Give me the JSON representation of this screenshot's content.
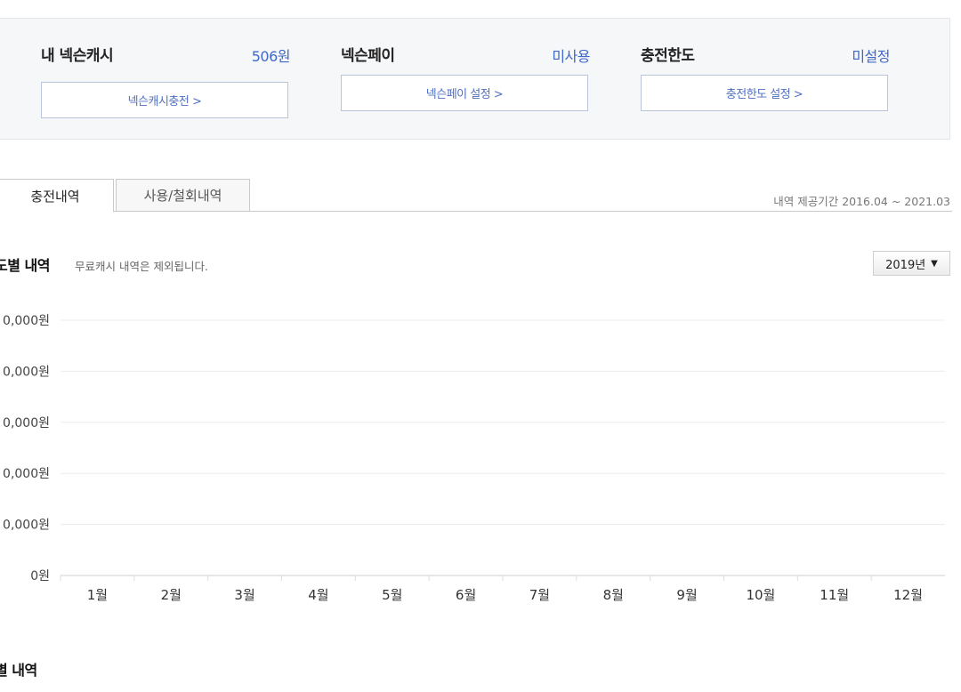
{
  "summary": {
    "cash": {
      "title": "내 넥슨캐시",
      "value": "506원",
      "button": "넥슨캐시충전 >"
    },
    "pay": {
      "title": "넥슨페이",
      "value": "미사용",
      "button": "넥슨페이 설정 >"
    },
    "limit": {
      "title": "충전한도",
      "value": "미설정",
      "button": "충전한도 설정 >"
    }
  },
  "tabs": [
    {
      "label": "충전내역",
      "active": true
    },
    {
      "label": "사용/철회내역",
      "active": false
    }
  ],
  "period_text": "내역 제공기간 2016.04 ~ 2021.03",
  "monthly_section": {
    "title": "도별 내역",
    "note": "무료캐시 내역은 제외됩니다.",
    "year_select": "2019년",
    "year_caret": "▼"
  },
  "chart_data": {
    "type": "bar",
    "categories": [
      "1월",
      "2월",
      "3월",
      "4월",
      "5월",
      "6월",
      "7월",
      "8월",
      "9월",
      "10월",
      "11월",
      "12월"
    ],
    "values": [
      0,
      0,
      0,
      0,
      0,
      0,
      0,
      0,
      0,
      0,
      0,
      0
    ],
    "y_tick_labels": [
      "0원",
      "0,000원",
      "0,000원",
      "0,000원",
      "0,000원",
      "0,000원"
    ],
    "grid": true,
    "gridline_color": "#ececec"
  },
  "bottom_section": {
    "title": "별 내역"
  }
}
